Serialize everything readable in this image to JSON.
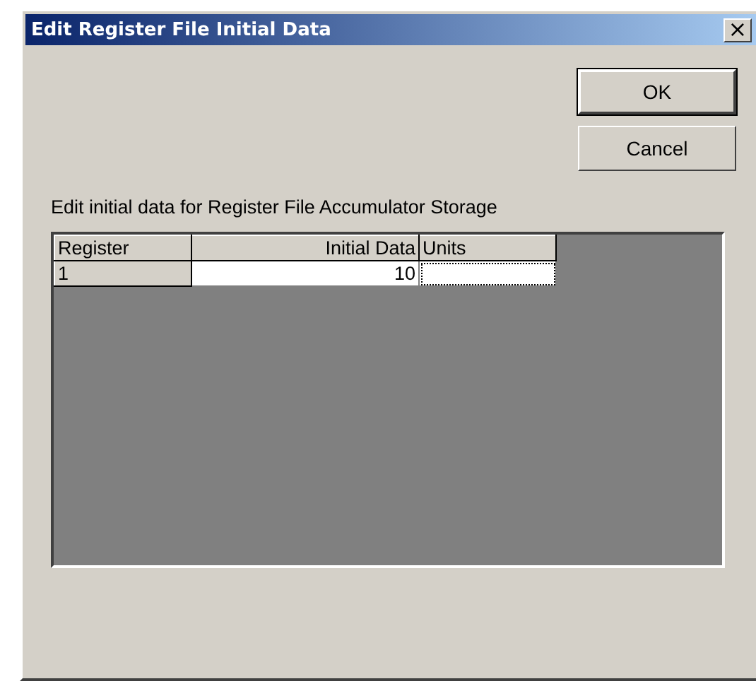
{
  "window": {
    "title": "Edit Register File Initial Data",
    "close": "×"
  },
  "buttons": [
    {
      "label": "OK",
      "default": true
    },
    {
      "label": "Cancel",
      "default": false
    }
  ],
  "description": "Edit initial data for Register File Accumulator Storage",
  "table": {
    "columns": [
      "Register",
      "Initial Data",
      "Units"
    ],
    "rows": [
      {
        "register": "1",
        "initial_data": "10",
        "units_focused": true
      }
    ]
  }
}
